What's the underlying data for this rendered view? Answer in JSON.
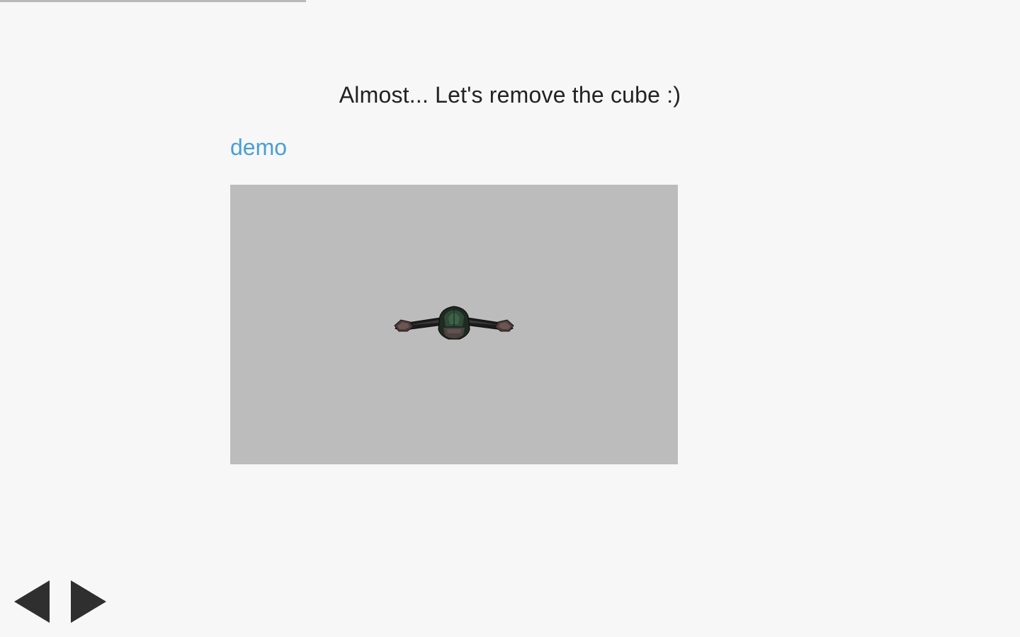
{
  "progress": {
    "fraction": 0.3,
    "color": "#b9b9b9"
  },
  "slide": {
    "title": "Almost... Let's remove the cube :)",
    "demo_link": "demo"
  },
  "viewport": {
    "background": "#bcbcbc",
    "subject_icon": "spaceship-model"
  },
  "navigation": {
    "prev_icon": "triangle-left-icon",
    "next_icon": "triangle-right-icon"
  },
  "colors": {
    "page_background": "#f7f7f7",
    "link": "#4a9fd5",
    "text": "#222222",
    "arrows": "#2f2f2f"
  }
}
